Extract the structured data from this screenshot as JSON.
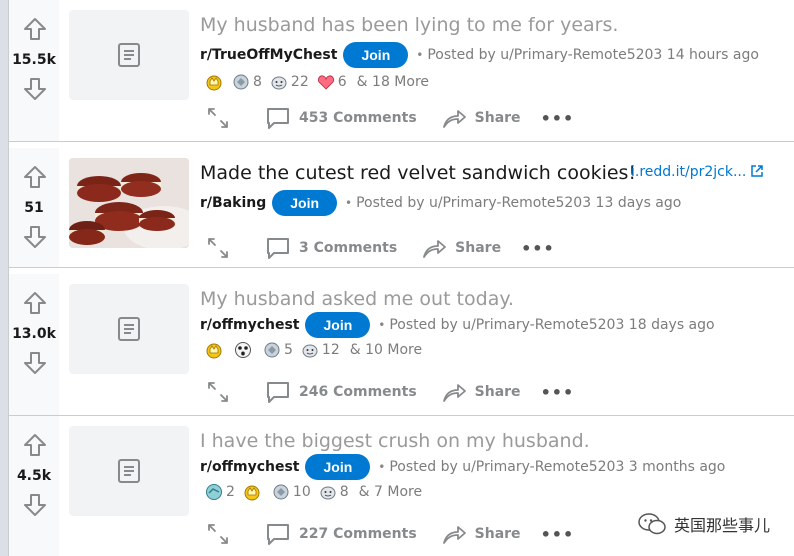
{
  "colors": {
    "accent": "#0079d3",
    "vote_bg": "#f8f9fa",
    "muted": "#7c7c7c"
  },
  "posts": [
    {
      "score": "15.5k",
      "title": "My husband has been lying to me for years.",
      "subreddit": "r/TrueOffMyChest",
      "join": "Join",
      "posted": "Posted by u/Primary-Remote5203 14 hours ago",
      "awards": [
        {
          "icon": "gold-award-icon",
          "count": ""
        },
        {
          "icon": "wholesome-award-icon",
          "count": "8"
        },
        {
          "icon": "silver-award-icon",
          "count": "22"
        },
        {
          "icon": "heart-award-icon",
          "count": "6"
        }
      ],
      "more": "& 18 More",
      "comments": "453 Comments",
      "share": "Share",
      "dots": "•••"
    },
    {
      "score": "51",
      "title": "Made the cutest red velvet sandwich cookies!",
      "link": "i.redd.it/pr2jck...",
      "subreddit": "r/Baking",
      "join": "Join",
      "posted": "Posted by u/Primary-Remote5203 13 days ago",
      "comments": "3 Comments",
      "share": "Share",
      "dots": "•••"
    },
    {
      "score": "13.0k",
      "title": "My husband asked me out today.",
      "subreddit": "r/offmychest",
      "join": "Join",
      "posted": "Posted by u/Primary-Remote5203 18 days ago",
      "awards": [
        {
          "icon": "gold-award-icon",
          "count": ""
        },
        {
          "icon": "wow-award-icon",
          "count": ""
        },
        {
          "icon": "wholesome-award-icon",
          "count": "5"
        },
        {
          "icon": "silver-award-icon",
          "count": "12"
        }
      ],
      "more": "& 10 More",
      "comments": "246 Comments",
      "share": "Share",
      "dots": "•••"
    },
    {
      "score": "4.5k",
      "title": "I have the biggest crush on my husband.",
      "subreddit": "r/offmychest",
      "join": "Join",
      "posted": "Posted by u/Primary-Remote5203 3 months ago",
      "awards": [
        {
          "icon": "helpful-award-icon",
          "count": "2"
        },
        {
          "icon": "gold-award-icon",
          "count": ""
        },
        {
          "icon": "wholesome-award-icon",
          "count": "10"
        },
        {
          "icon": "silver-award-icon",
          "count": "8"
        }
      ],
      "more": "& 7 More",
      "comments": "227 Comments",
      "share": "Share",
      "dots": "•••"
    }
  ],
  "watermark": "英国那些事儿"
}
